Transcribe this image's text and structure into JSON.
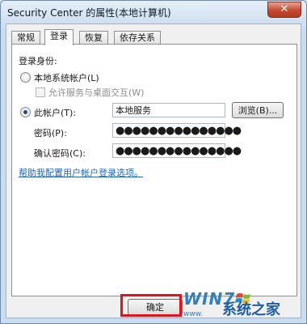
{
  "window": {
    "title": "Security Center 的属性(本地计算机)",
    "close_glyph": "✕"
  },
  "tabs": [
    {
      "label": "常规",
      "active": false
    },
    {
      "label": "登录",
      "active": true
    },
    {
      "label": "恢复",
      "active": false
    },
    {
      "label": "依存关系",
      "active": false
    }
  ],
  "logon": {
    "section_label": "登录身份:",
    "local_system": {
      "label": "本地系统帐户(L)",
      "selected": false
    },
    "desktop_interact": {
      "label": "允许服务与桌面交互(W)",
      "checked": false,
      "enabled": false
    },
    "this_account": {
      "label": "此帐户(T):",
      "selected": true,
      "value": "本地服务"
    },
    "browse_button": "浏览(B)...",
    "password": {
      "label": "密码(P):",
      "value": "●●●●●●●●●●●●●●●"
    },
    "confirm_password": {
      "label": "确认密码(C):",
      "value": "●●●●●●●●●●●●●●●"
    },
    "help_link": "帮助我配置用户帐户登录选项。"
  },
  "footer": {
    "ok_button": "确定",
    "ok_highlight_color": "#e0151b"
  },
  "watermark": {
    "brand": "WIN7",
    "site": "www.",
    "name": "系统之家"
  }
}
